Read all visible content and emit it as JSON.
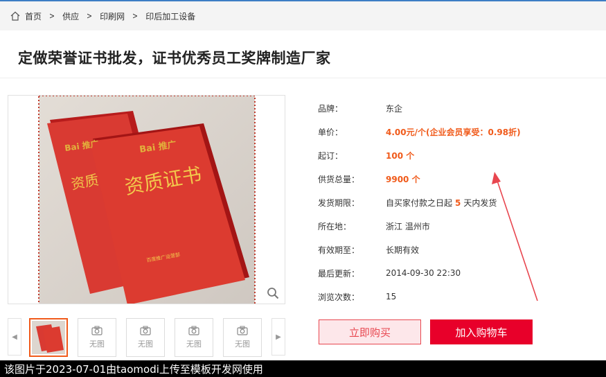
{
  "breadcrumb": {
    "items": [
      "首页",
      "供应",
      "印刷网",
      "印后加工设备"
    ]
  },
  "product": {
    "title": "定做荣誉证书批发，证书优秀员工奖牌制造厂家",
    "image": {
      "cover_brand": "Bai 推广",
      "cover_title": "资质证书",
      "cover_sub": "百度推广运营部"
    }
  },
  "thumbnails": {
    "no_image_label": "无图",
    "items": [
      "active",
      "无图",
      "无图",
      "无图",
      "无图"
    ]
  },
  "details": [
    {
      "label": "品牌：",
      "value": "东企"
    },
    {
      "label": "单价：",
      "value": "4.00元/个(企业会员享受：0.98折)"
    },
    {
      "label": "起订：",
      "value": "100 个"
    },
    {
      "label": "供货总量：",
      "value": "9900 个"
    },
    {
      "label": "发货期限：",
      "value_pre": "自买家付款之日起",
      "value_num": "5",
      "value_post": "天内发货"
    },
    {
      "label": "所在地：",
      "value": "浙江 温州市"
    },
    {
      "label": "有效期至：",
      "value": "长期有效"
    },
    {
      "label": "最后更新：",
      "value": "2014-09-30 22:30"
    },
    {
      "label": "浏览次数：",
      "value": "15"
    }
  ],
  "buttons": {
    "buy_now": "立即购买",
    "add_to_cart": "加入购物车"
  },
  "footer": {
    "text": "该图片于2023-07-01由taomodi上传至模板开发网使用"
  },
  "colors": {
    "accent_orange": "#f05a1a",
    "brand_red": "#e8002a",
    "annotation_arrow": "#e8464f"
  },
  "icons": [
    "home-icon",
    "chevron-right-icon",
    "zoom-icon",
    "camera-icon",
    "arrow-left-icon",
    "arrow-right-icon"
  ]
}
